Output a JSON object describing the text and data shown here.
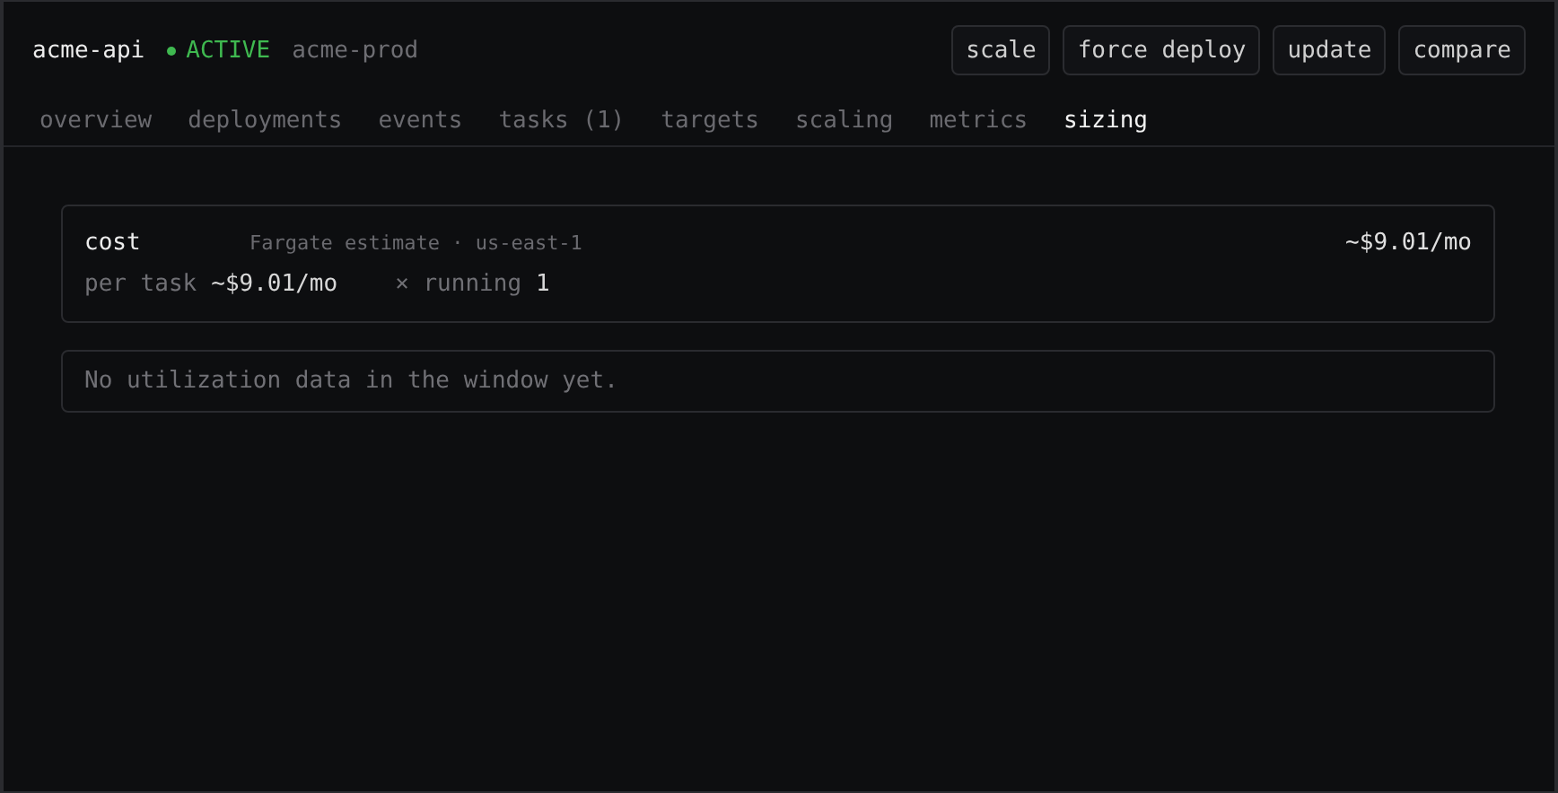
{
  "service": {
    "name": "acme-api",
    "status": {
      "label": "ACTIVE",
      "kind": "active"
    },
    "cluster": "acme-prod"
  },
  "actions": [
    "scale",
    "force deploy",
    "update",
    "compare"
  ],
  "tabs": [
    {
      "label": "overview",
      "selected": false
    },
    {
      "label": "deployments",
      "selected": false
    },
    {
      "label": "events",
      "selected": false
    },
    {
      "label": "tasks (1)",
      "selected": false
    },
    {
      "label": "targets",
      "selected": false
    },
    {
      "label": "scaling",
      "selected": false
    },
    {
      "label": "metrics",
      "selected": false
    },
    {
      "label": "sizing",
      "selected": true
    }
  ],
  "cost_card": {
    "title": "cost",
    "subtitle": "Fargate estimate · us-east-1",
    "total": "~$9.01/mo",
    "per_task_label": "per task",
    "per_task_value": "~$9.01/mo",
    "running_label": "× running",
    "running_value": "1"
  },
  "utilization_message": "No utilization data in the window yet."
}
